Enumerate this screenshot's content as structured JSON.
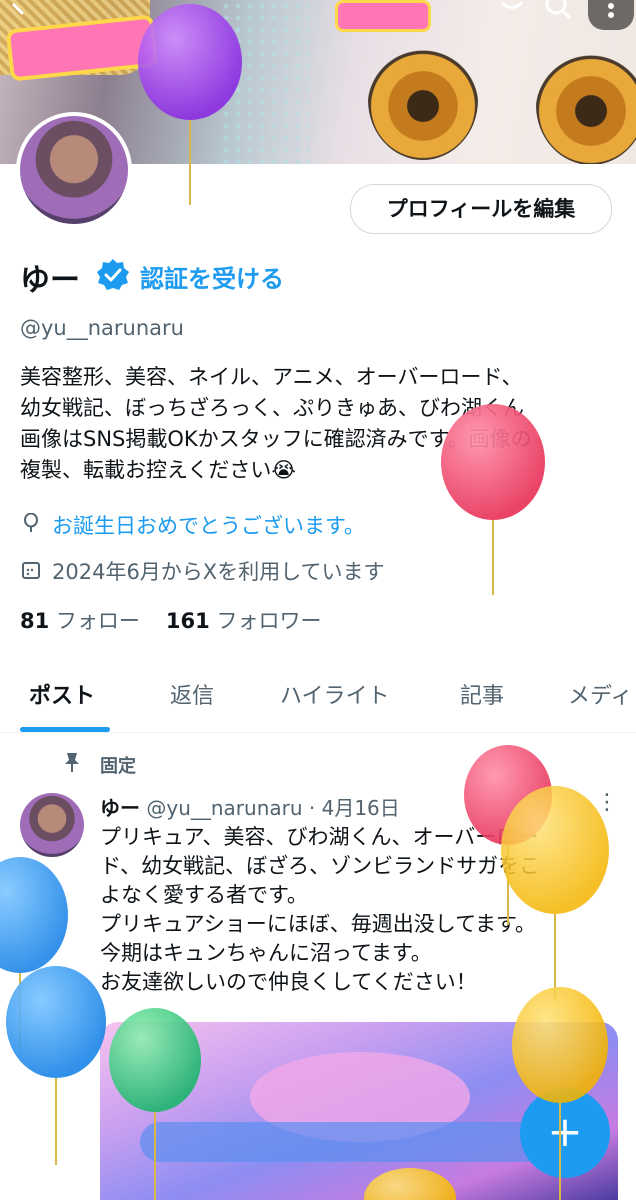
{
  "header": {
    "back_icon": "back-arrow-icon",
    "share_icon": "share-icon",
    "search_icon": "search-icon",
    "more_icon": "more-icon"
  },
  "profile": {
    "edit_button": "プロフィールを編集",
    "name": "ゆー",
    "get_verified": "認証を受ける",
    "handle": "@yu__narunaru",
    "bio_lines": [
      "美容整形、美容、ネイル、アニメ、オーバーロード、",
      "幼女戦記、ぼっちざろっく、ぷりきゅあ、びわ湖くん",
      "画像はSNS掲載OKかスタッフに確認済みです。画像の",
      "複製、転載お控えください😭"
    ],
    "birthday_text": "お誕生日おめでとうございます。",
    "joined_text": "2024年6月からXを利用しています",
    "following_count": "81",
    "following_label": "フォロー",
    "followers_count": "161",
    "followers_label": "フォロワー"
  },
  "tabs": [
    "ポスト",
    "返信",
    "ハイライト",
    "記事",
    "メディ"
  ],
  "active_tab": "ポスト",
  "pinned_post": {
    "pinned_label": "固定",
    "author_name": "ゆー",
    "author_handle": "@yu__narunaru",
    "date": "· 4月16日",
    "text_lines": [
      "プリキュア、美容、びわ湖くん、オーバーロー",
      "ド、幼女戦記、ぼざろ、ゾンビランドサガをこ",
      "よなく愛する者です。",
      "プリキュアショーにほぼ、毎週出没してます。",
      "今期はキュンちゃんに沼ってます。",
      "お友達欲しいので仲良くしてください！"
    ]
  },
  "fab_label": "+",
  "colors": {
    "accent": "#1d9bf0",
    "text": "#0f1419",
    "secondary_text": "#536471"
  }
}
